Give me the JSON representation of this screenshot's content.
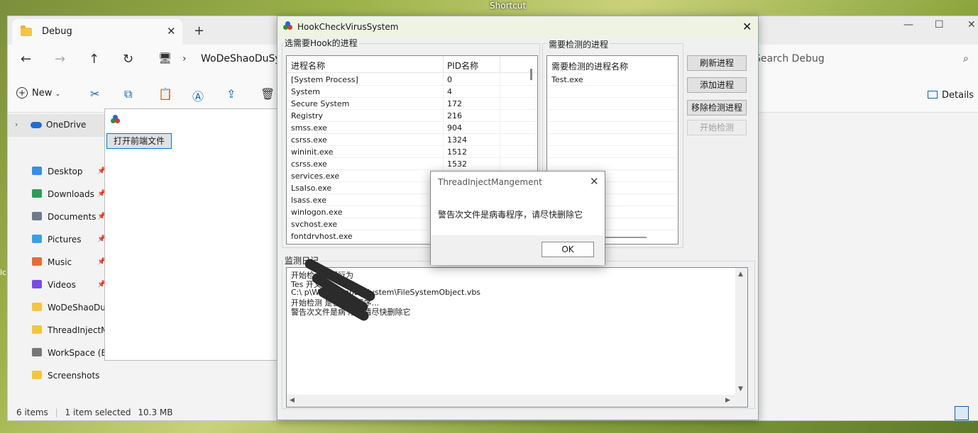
{
  "desktop": {
    "top_label": "Shortcut",
    "left_label": "lc"
  },
  "explorer": {
    "tab_title": "Debug",
    "address": "WoDeShaoDuSyst",
    "search_placeholder": "Search Debug",
    "toolbar": {
      "new_label": "New",
      "details_label": "Details"
    },
    "sidebar": {
      "onedrive": "OneDrive",
      "items": [
        {
          "label": "Desktop",
          "pinned": true,
          "color": "#3a8ee6"
        },
        {
          "label": "Downloads",
          "pinned": true,
          "color": "#2a9d5a"
        },
        {
          "label": "Documents",
          "pinned": true,
          "color": "#6e7b8b"
        },
        {
          "label": "Pictures",
          "pinned": true,
          "color": "#3aa0e6"
        },
        {
          "label": "Music",
          "pinned": true,
          "color": "#e86a3a"
        },
        {
          "label": "Videos",
          "pinned": true,
          "color": "#7a4ae6"
        },
        {
          "label": "WoDeShaoDuSy",
          "pinned": false,
          "color": "#f4c542"
        },
        {
          "label": "ThreadInjectMar",
          "pinned": false,
          "color": "#f4c542"
        },
        {
          "label": "WorkSpace (E:)",
          "pinned": false,
          "color": "#777777"
        },
        {
          "label": "Screenshots",
          "pinned": false,
          "color": "#f4c542"
        }
      ],
      "pin_glyph": "📌"
    },
    "status": {
      "items": "6 items",
      "selected": "1 item selected",
      "size": "10.3 MB"
    }
  },
  "small_window": {
    "open_button": "打开前端文件"
  },
  "main_window": {
    "title": "HookCheckVirusSystem",
    "left_group_label": "选需要Hook的进程",
    "right_group_label": "需要检测的进程",
    "process_headers": [
      "进程名称",
      "PID名称"
    ],
    "processes": [
      {
        "name": "[System Process]",
        "pid": "0"
      },
      {
        "name": "System",
        "pid": "4"
      },
      {
        "name": "Secure System",
        "pid": "172"
      },
      {
        "name": "Registry",
        "pid": "216"
      },
      {
        "name": "smss.exe",
        "pid": "904"
      },
      {
        "name": "csrss.exe",
        "pid": "1324"
      },
      {
        "name": "wininit.exe",
        "pid": "1512"
      },
      {
        "name": "csrss.exe",
        "pid": "1532"
      },
      {
        "name": "services.exe",
        "pid": ""
      },
      {
        "name": "LsaIso.exe",
        "pid": ""
      },
      {
        "name": "lsass.exe",
        "pid": ""
      },
      {
        "name": "winlogon.exe",
        "pid": ""
      },
      {
        "name": "svchost.exe",
        "pid": ""
      },
      {
        "name": "fontdrvhost.exe",
        "pid": ""
      }
    ],
    "target_header": "需要检测的进程名称",
    "targets": [
      "Test.exe"
    ],
    "buttons": {
      "refresh": "刷新进程",
      "add": "添加进程",
      "remove": "移除检测进程",
      "start": "开始检测"
    },
    "log_label": "监测日记",
    "log_lines": [
      "开始检测进程行为",
      "Tes          开文件",
      "C:\\              p\\WoDeShaoDuSystem\\FileSystemObject.vbs",
      "开始检测         是否病毒程序...",
      "警告次文件是病      序，请尽快删除它"
    ]
  },
  "message_box": {
    "title": "ThreadInjectMangement",
    "text": "警告次文件是病毒程序，请尽快删除它",
    "ok": "OK"
  }
}
